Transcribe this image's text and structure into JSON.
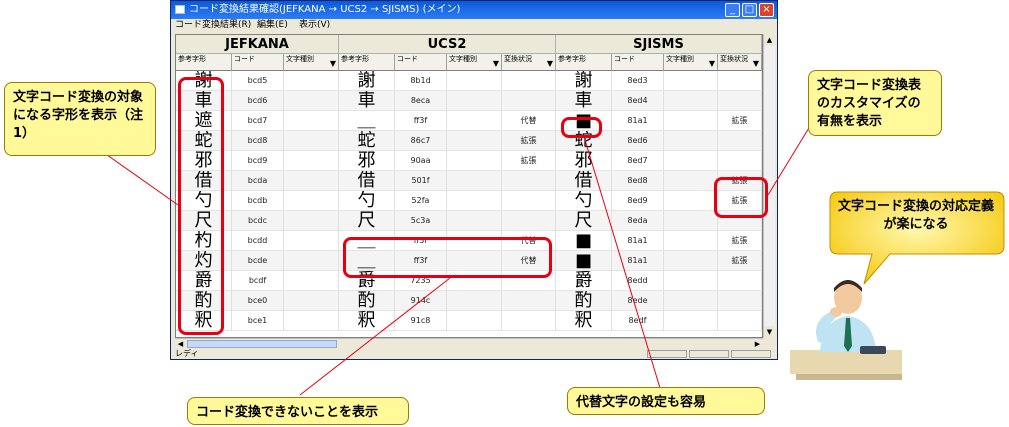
{
  "window": {
    "title": "コード変換結果確認(JEFKANA → UCS2 → SJISMS) (メイン)",
    "buttons": {
      "minimize": "_",
      "maximize": "□",
      "close": "×"
    }
  },
  "menu": {
    "items": [
      "コード変換結果(R)",
      "編集(E)",
      "表示(V)"
    ]
  },
  "groups": [
    "JEFKANA",
    "UCS2",
    "SJISMS"
  ],
  "columns": {
    "glyph": "参考字形",
    "code": "コード",
    "chartype": "文字種別",
    "status": "変換状況"
  },
  "rows": [
    {
      "jef": {
        "g": "謝",
        "c": "bcd5"
      },
      "ucs": {
        "g": "謝",
        "c": "8b1d",
        "s": ""
      },
      "sjis": {
        "g": "謝",
        "c": "8ed3",
        "s": ""
      }
    },
    {
      "jef": {
        "g": "車",
        "c": "bcd6"
      },
      "ucs": {
        "g": "車",
        "c": "8eca",
        "s": ""
      },
      "sjis": {
        "g": "車",
        "c": "8ed4",
        "s": ""
      }
    },
    {
      "jef": {
        "g": "遮",
        "c": "bcd7"
      },
      "ucs": {
        "g": "＿",
        "c": "ff3f",
        "s": "代替"
      },
      "sjis": {
        "g": "■",
        "c": "81a1",
        "s": "拡張"
      }
    },
    {
      "jef": {
        "g": "蛇",
        "c": "bcd8"
      },
      "ucs": {
        "g": "蛇",
        "c": "86c7",
        "s": "拡張"
      },
      "sjis": {
        "g": "蛇",
        "c": "8ed6",
        "s": ""
      }
    },
    {
      "jef": {
        "g": "邪",
        "c": "bcd9"
      },
      "ucs": {
        "g": "邪",
        "c": "90aa",
        "s": "拡張"
      },
      "sjis": {
        "g": "邪",
        "c": "8ed7",
        "s": ""
      }
    },
    {
      "jef": {
        "g": "借",
        "c": "bcda"
      },
      "ucs": {
        "g": "借",
        "c": "501f",
        "s": ""
      },
      "sjis": {
        "g": "借",
        "c": "8ed8",
        "s": "拡張"
      }
    },
    {
      "jef": {
        "g": "勺",
        "c": "bcdb"
      },
      "ucs": {
        "g": "勺",
        "c": "52fa",
        "s": ""
      },
      "sjis": {
        "g": "勺",
        "c": "8ed9",
        "s": "拡張"
      }
    },
    {
      "jef": {
        "g": "尺",
        "c": "bcdc"
      },
      "ucs": {
        "g": "尺",
        "c": "5c3a",
        "s": ""
      },
      "sjis": {
        "g": "尺",
        "c": "8eda",
        "s": ""
      }
    },
    {
      "jef": {
        "g": "杓",
        "c": "bcdd"
      },
      "ucs": {
        "g": "＿",
        "c": "ff3f",
        "s": "代替"
      },
      "sjis": {
        "g": "■",
        "c": "81a1",
        "s": "拡張"
      }
    },
    {
      "jef": {
        "g": "灼",
        "c": "bcde"
      },
      "ucs": {
        "g": "＿",
        "c": "ff3f",
        "s": "代替"
      },
      "sjis": {
        "g": "■",
        "c": "81a1",
        "s": "拡張"
      }
    },
    {
      "jef": {
        "g": "爵",
        "c": "bcdf"
      },
      "ucs": {
        "g": "爵",
        "c": "7235",
        "s": ""
      },
      "sjis": {
        "g": "爵",
        "c": "8edd",
        "s": ""
      }
    },
    {
      "jef": {
        "g": "酌",
        "c": "bce0"
      },
      "ucs": {
        "g": "酌",
        "c": "914c",
        "s": ""
      },
      "sjis": {
        "g": "酌",
        "c": "8ede",
        "s": ""
      }
    },
    {
      "jef": {
        "g": "釈",
        "c": "bce1"
      },
      "ucs": {
        "g": "釈",
        "c": "91c8",
        "s": ""
      },
      "sjis": {
        "g": "釈",
        "c": "8edf",
        "s": ""
      }
    }
  ],
  "status_bar": {
    "text": "レディ"
  },
  "callouts": {
    "left": "文字コード変換の対象になる字形を表示（注1）",
    "right_top": "文字コード変換表のカスタマイズの有無を表示",
    "right_bubble": "文字コード変換の対応定義が楽になる",
    "bottom_left": "コード変換できないことを表示",
    "bottom_right": "代替文字の設定も容易"
  },
  "colors": {
    "highlight": "#e60012",
    "callout_fill": "#fff99a",
    "title_bar": "#0a5ad8"
  }
}
